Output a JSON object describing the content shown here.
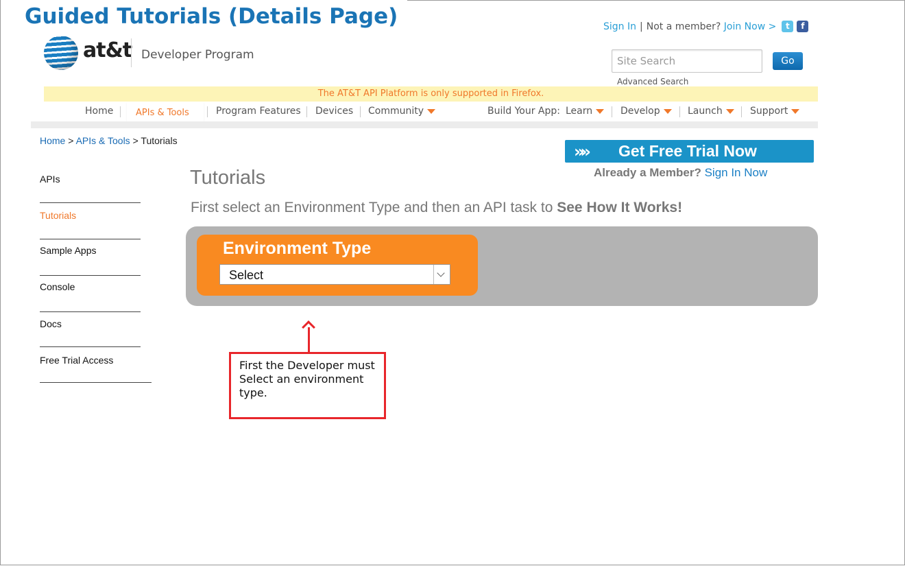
{
  "doc_title": "Guided Tutorials (Details Page)",
  "header": {
    "logo_word": "at&t",
    "program_name": "Developer Program",
    "sign_in": "Sign In",
    "separator": "|",
    "not_member": "Not a member?",
    "join_now": "Join Now >",
    "search_placeholder": "Site Search",
    "go_label": "Go",
    "advanced_search": "Advanced Search"
  },
  "notice": "The AT&T API Platform is only supported in Firefox.",
  "nav": {
    "home": "Home",
    "apis_tools": "APIs & Tools",
    "program_features": "Program Features",
    "devices": "Devices",
    "community": "Community",
    "build_your_app": "Build Your App:",
    "learn": "Learn",
    "develop": "Develop",
    "launch": "Launch",
    "support": "Support"
  },
  "breadcrumb": {
    "home": "Home",
    "apis_tools": "APIs & Tools",
    "sep": ">",
    "current": "Tutorials"
  },
  "sidebar": {
    "items": [
      "APIs",
      "Tutorials",
      "Sample Apps",
      "Console",
      "Docs",
      "Free Trial Access"
    ],
    "active": "Tutorials"
  },
  "cta": {
    "trial_label": "Get Free Trial Now",
    "already_member": "Already a Member?",
    "sign_in_now": "Sign In Now"
  },
  "main": {
    "title": "Tutorials",
    "instruction_prefix": "First select an Environment Type and then an API task to",
    "instruction_bold": "See How It Works!",
    "env_label": "Environment Type",
    "env_select_value": "Select"
  },
  "annotation": {
    "text": "First the Developer must Select an environment type."
  },
  "colors": {
    "brand_blue": "#1a74b5",
    "accent_orange": "#f98a21",
    "panel_gray": "#b3b3b3",
    "annotation_red": "#e8262b",
    "notice_bg": "#fdf4b7"
  },
  "icons": [
    "att-globe-icon",
    "twitter-icon",
    "facebook-icon",
    "chevron-down-icon",
    "double-chevron-icon",
    "arrow-up-icon"
  ]
}
